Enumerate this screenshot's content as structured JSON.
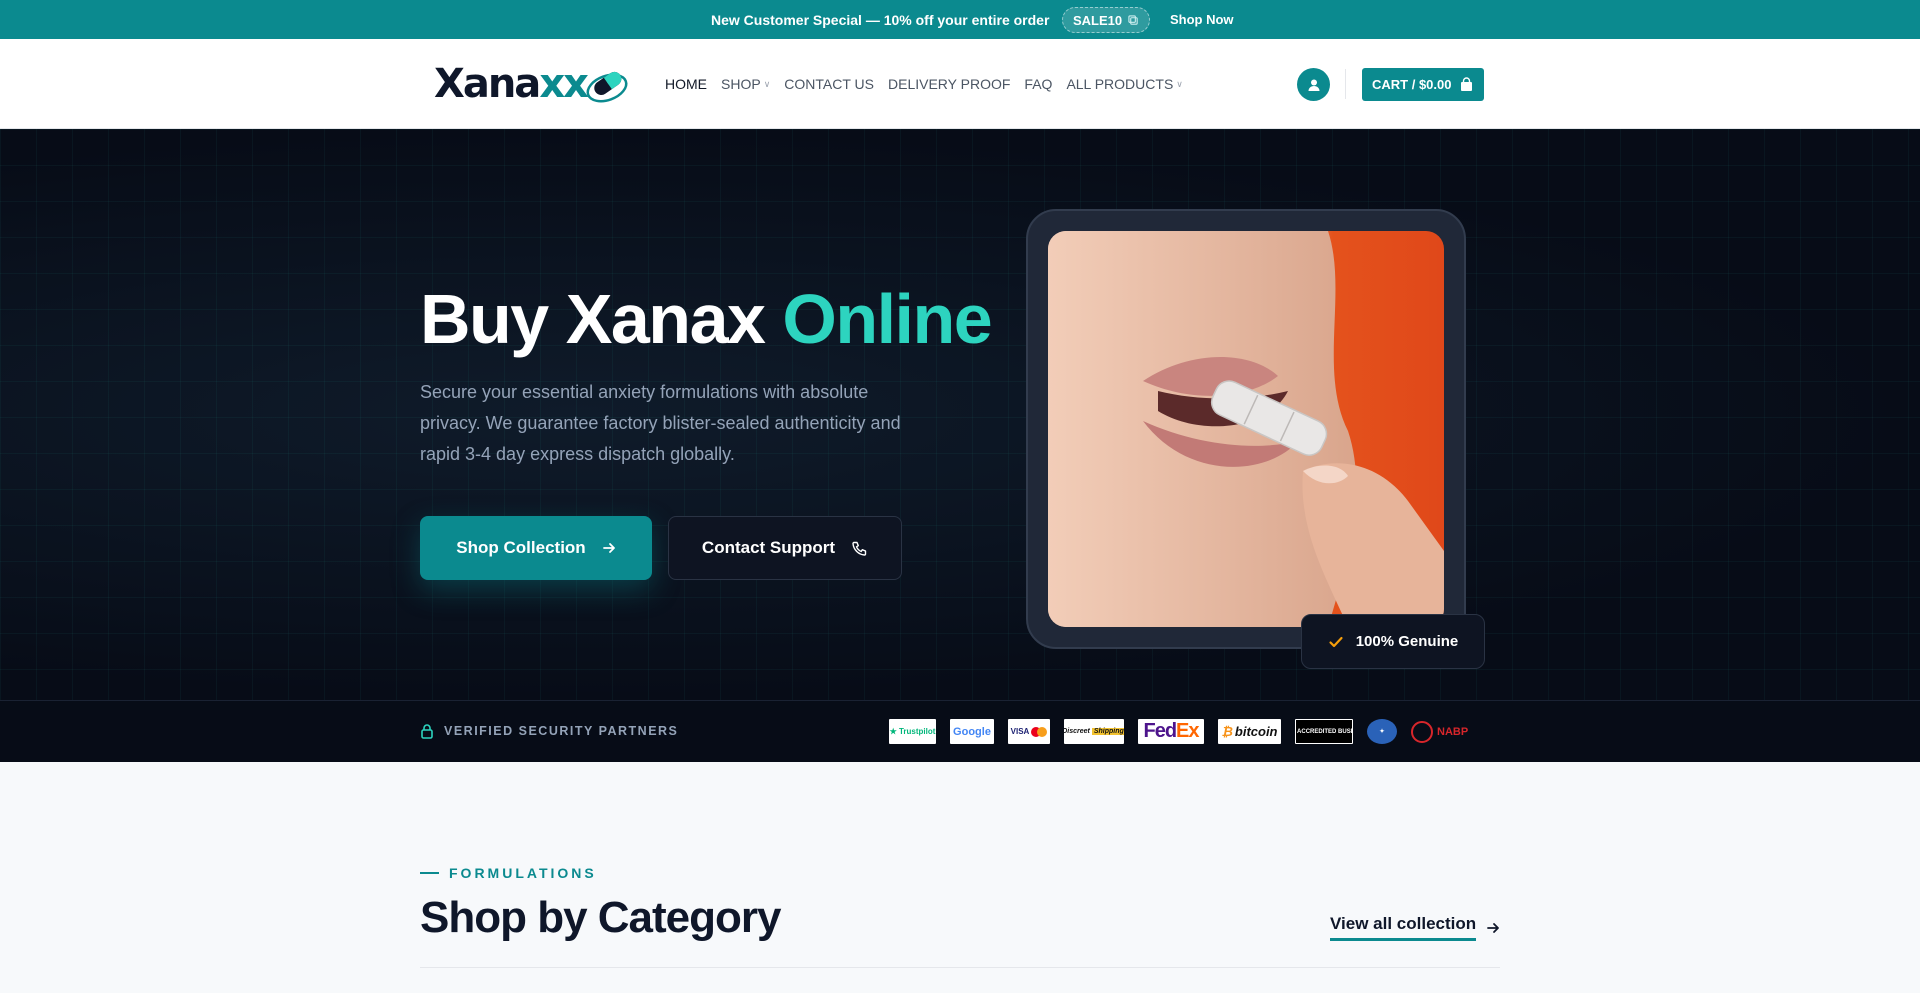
{
  "promo": {
    "message": "New Customer Special — 10% off your entire order",
    "code": "SALE10",
    "cta": "Shop Now"
  },
  "header": {
    "logo": "Xanaxx",
    "nav": [
      {
        "label": "HOME",
        "active": true
      },
      {
        "label": "SHOP",
        "dropdown": true
      },
      {
        "label": "CONTACT US"
      },
      {
        "label": "DELIVERY PROOF"
      },
      {
        "label": "FAQ"
      },
      {
        "label": "ALL PRODUCTS",
        "dropdown": true
      }
    ],
    "cart_label": "CART / $0.00"
  },
  "hero": {
    "title_main": "Buy Xanax",
    "title_accent": "Online",
    "description": "Secure your essential anxiety formulations with absolute privacy. We guarantee factory blister-sealed authenticity and rapid 3-4 day express dispatch globally.",
    "primary_cta": "Shop Collection",
    "secondary_cta": "Contact Support",
    "badge": "100% Genuine"
  },
  "partners": {
    "label": "VERIFIED SECURITY PARTNERS",
    "logos": [
      "Trustpilot",
      "Google",
      "VISA / Mastercard",
      "Discreet Shipping",
      "FedEx",
      "bitcoin",
      "BBB Accredited Business",
      "seal",
      "NABP"
    ]
  },
  "categories": {
    "eyebrow": "FORMULATIONS",
    "title": "Shop by Category",
    "view_all": "View all collection"
  },
  "colors": {
    "brand": "#0b8a8f",
    "accent": "#2dd4bf",
    "hero_bg": "#070c17"
  }
}
